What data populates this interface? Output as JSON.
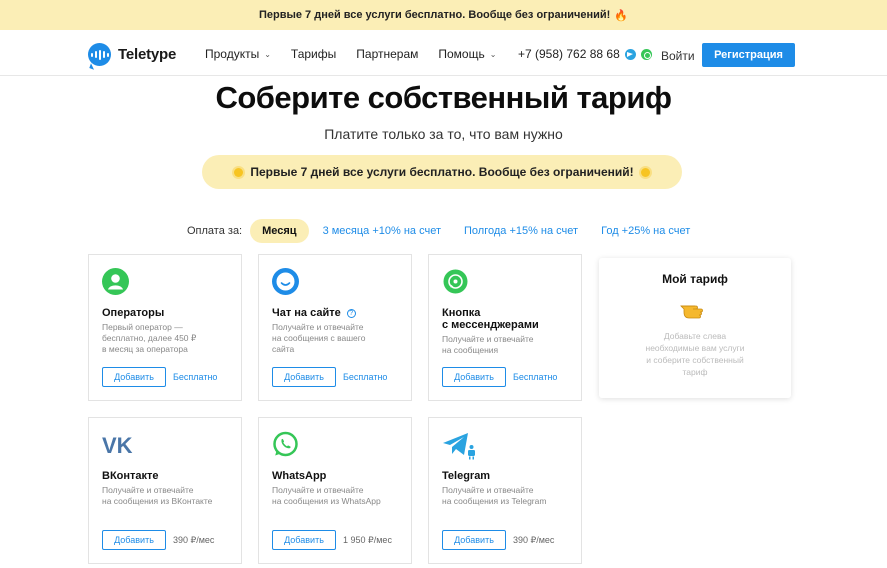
{
  "promo_bar": {
    "text": "Первые 7 дней все услуги бесплатно. Вообще без ограничений!",
    "icon": "fire-icon"
  },
  "header": {
    "logo_text": "Teletype",
    "nav": [
      {
        "label": "Продукты",
        "has_caret": true
      },
      {
        "label": "Тарифы",
        "has_caret": false
      },
      {
        "label": "Партнерам",
        "has_caret": false
      },
      {
        "label": "Помощь",
        "has_caret": true
      }
    ],
    "phone": "+7 (958) 762 88 68",
    "login_label": "Войти",
    "register_label": "Регистрация"
  },
  "hero": {
    "title": "Соберите собственный тариф",
    "subtitle": "Платите только за то, что вам нужно",
    "promo": "Первые 7 дней все услуги бесплатно. Вообще без ограничений!"
  },
  "payment": {
    "label": "Оплата за:",
    "options": [
      {
        "label": "Месяц",
        "active": true
      },
      {
        "label": "3 месяца +10% на счет",
        "active": false
      },
      {
        "label": "Полгода +15% на счет",
        "active": false
      },
      {
        "label": "Год +25% на счет",
        "active": false
      }
    ]
  },
  "cards": [
    {
      "icon": "operator-icon",
      "title": "Операторы",
      "desc_lines": [
        "Первый оператор —",
        "бесплатно, далее 450 ₽",
        "в месяц за оператора"
      ],
      "add_label": "Добавить",
      "price": "Бесплатно"
    },
    {
      "icon": "chat-icon",
      "title": "Чат на сайте",
      "desc_lines": [
        "Получайте и отвечайте",
        "на сообщения с вашего",
        "сайта"
      ],
      "add_label": "Добавить",
      "price": "Бесплатно"
    },
    {
      "icon": "whatsapp-round-icon",
      "title_lines": [
        "Кнопка",
        "с мессенджерами"
      ],
      "desc_lines": [
        "Получайте и отвечайте",
        "на сообщения"
      ],
      "add_label": "Добавить",
      "price": "Бесплатно"
    },
    {
      "icon": "vk-icon",
      "title": "ВКонтакте",
      "desc_lines": [
        "Получайте и отвечайте",
        "на сообщения из ВКонтакте"
      ],
      "add_label": "Добавить",
      "price": "390 ₽/мес"
    },
    {
      "icon": "whatsapp-icon",
      "title": "WhatsApp",
      "desc_lines": [
        "Получайте и отвечайте",
        "на сообщения из WhatsApp"
      ],
      "add_label": "Добавить",
      "price": "1 950 ₽/мес"
    },
    {
      "icon": "telegram-bot-icon",
      "title": "Telegram",
      "desc_lines": [
        "Получайте и отвечайте",
        "на сообщения из Telegram"
      ],
      "add_label": "Добавить",
      "price": "390 ₽/мес"
    }
  ],
  "my_tariff": {
    "title": "Мой тариф",
    "text_lines": [
      "Добавьте слева",
      "необходимые вам услуги",
      "и соберите собственный",
      "тариф"
    ]
  },
  "colors": {
    "accent": "#1e8ce7",
    "promo_bg": "#fbeeb6",
    "green": "#35c657",
    "vk": "#4a76a8"
  }
}
